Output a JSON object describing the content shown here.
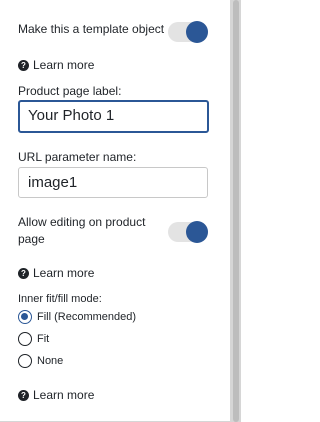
{
  "template_object": {
    "label": "Make this a template object",
    "toggle_on": true,
    "learn_more": "Learn more"
  },
  "product_page_label": {
    "label": "Product page label:",
    "value": "Your Photo 1"
  },
  "url_parameter": {
    "label": "URL parameter name:",
    "value": "image1"
  },
  "allow_editing": {
    "label_line1": "Allow editing on product",
    "label_line2": "page",
    "toggle_on": true,
    "learn_more": "Learn more"
  },
  "fit_mode": {
    "label": "Inner fit/fill mode:",
    "options": [
      "Fill (Recommended)",
      "Fit",
      "None"
    ],
    "selected": "Fill (Recommended)",
    "learn_more": "Learn more"
  },
  "help_icon_glyph": "?",
  "colors": {
    "accent": "#2b5796",
    "toggle_track": "#e3e3e3",
    "text": "#1f2328"
  }
}
